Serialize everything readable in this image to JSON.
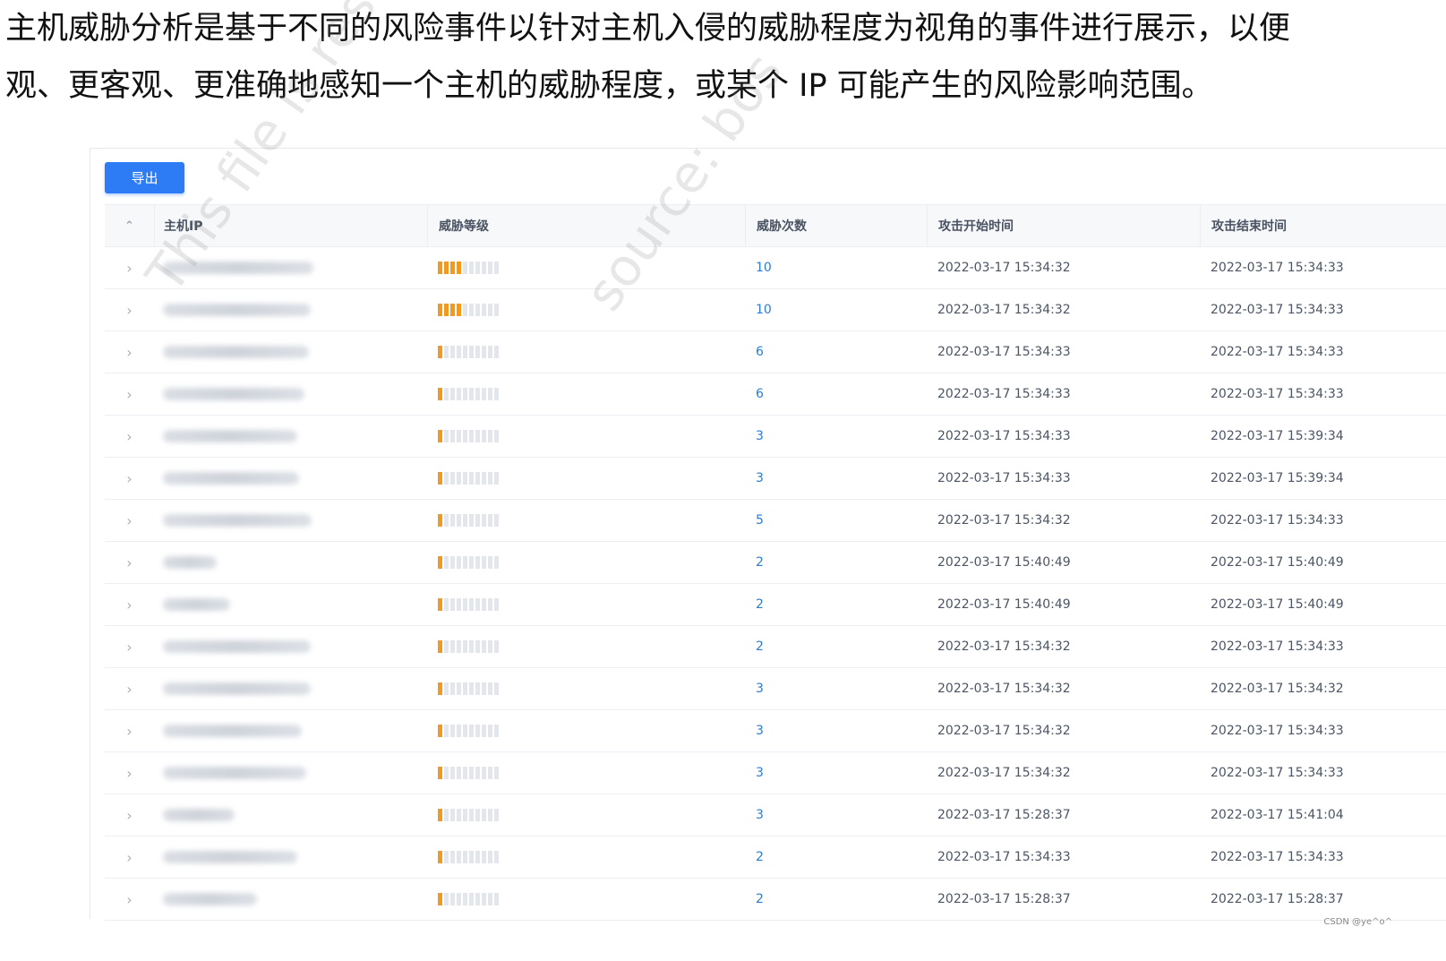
{
  "intro": {
    "line1": "主机威胁分析是基于不同的风险事件以针对主机入侵的威胁程度为视角的事件进行展示，以便",
    "line2": "观、更客观、更准确地感知一个主机的威胁程度，或某个 IP 可能产生的风险影响范围。"
  },
  "toolbar": {
    "export_label": "导出"
  },
  "table": {
    "headers": {
      "expand": "⌃",
      "ip": "主机IP",
      "level": "威胁等级",
      "count": "威胁次数",
      "start": "攻击开始时间",
      "end": "攻击结束时间"
    },
    "rows": [
      {
        "level": 4,
        "count": "10",
        "start": "2022-03-17 15:34:32",
        "end": "2022-03-17 15:34:33"
      },
      {
        "level": 4,
        "count": "10",
        "start": "2022-03-17 15:34:32",
        "end": "2022-03-17 15:34:33"
      },
      {
        "level": 1,
        "count": "6",
        "start": "2022-03-17 15:34:33",
        "end": "2022-03-17 15:34:33"
      },
      {
        "level": 1,
        "count": "6",
        "start": "2022-03-17 15:34:33",
        "end": "2022-03-17 15:34:33"
      },
      {
        "level": 1,
        "count": "3",
        "start": "2022-03-17 15:34:33",
        "end": "2022-03-17 15:39:34"
      },
      {
        "level": 1,
        "count": "3",
        "start": "2022-03-17 15:34:33",
        "end": "2022-03-17 15:39:34"
      },
      {
        "level": 1,
        "count": "5",
        "start": "2022-03-17 15:34:32",
        "end": "2022-03-17 15:34:33"
      },
      {
        "level": 1,
        "count": "2",
        "start": "2022-03-17 15:40:49",
        "end": "2022-03-17 15:40:49"
      },
      {
        "level": 1,
        "count": "2",
        "start": "2022-03-17 15:40:49",
        "end": "2022-03-17 15:40:49"
      },
      {
        "level": 1,
        "count": "2",
        "start": "2022-03-17 15:34:32",
        "end": "2022-03-17 15:34:33"
      },
      {
        "level": 1,
        "count": "3",
        "start": "2022-03-17 15:34:32",
        "end": "2022-03-17 15:34:32"
      },
      {
        "level": 1,
        "count": "3",
        "start": "2022-03-17 15:34:32",
        "end": "2022-03-17 15:34:33"
      },
      {
        "level": 1,
        "count": "3",
        "start": "2022-03-17 15:34:32",
        "end": "2022-03-17 15:34:33"
      },
      {
        "level": 1,
        "count": "3",
        "start": "2022-03-17 15:28:37",
        "end": "2022-03-17 15:41:04"
      },
      {
        "level": 1,
        "count": "2",
        "start": "2022-03-17 15:34:33",
        "end": "2022-03-17 15:34:33"
      },
      {
        "level": 1,
        "count": "2",
        "start": "2022-03-17 15:28:37",
        "end": "2022-03-17 15:28:37"
      }
    ]
  },
  "level_max": 10,
  "colors": {
    "accent": "#2d7cf5",
    "level_on": "#f29a1f",
    "level_off": "#e3e6eb",
    "count": "#2b7cd8"
  },
  "watermark": {
    "text1": "This file is restricted to the re",
    "text2": "source: bos"
  },
  "credit": "CSDN @ye^o^"
}
